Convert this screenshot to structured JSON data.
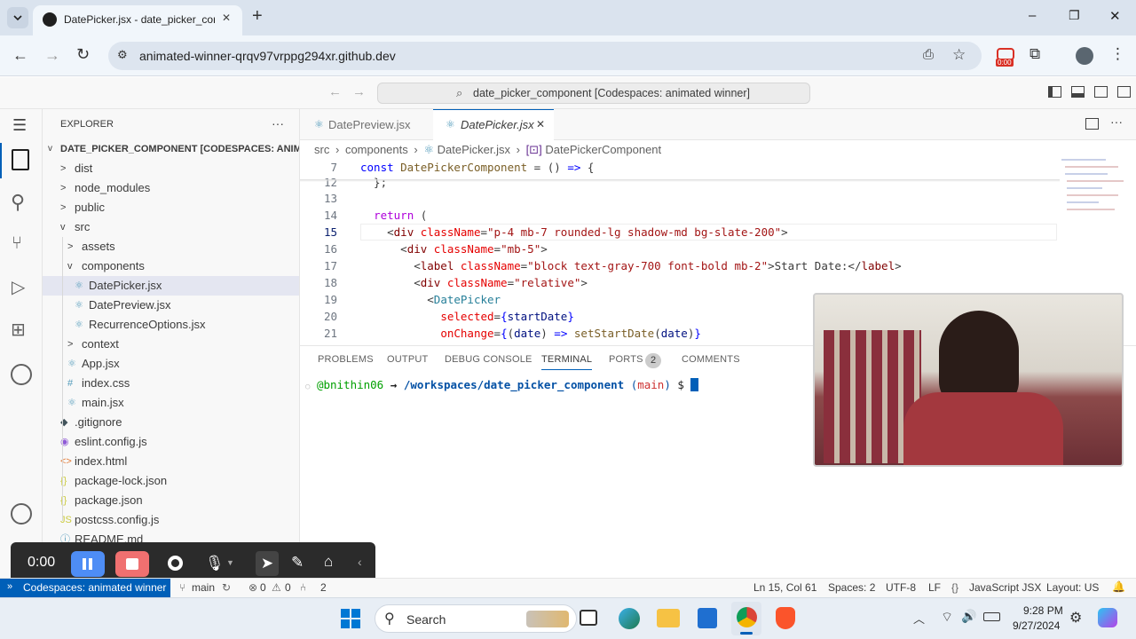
{
  "browser": {
    "tab_title": "DatePicker.jsx - date_picker_cor",
    "new_tab_symbol": "+",
    "url": "animated-winner-qrqv97vrppg294xr.github.dev",
    "recording_badge": "0:00",
    "window_controls": {
      "minimize": "–",
      "restore": "❐",
      "close": "✕"
    }
  },
  "vscode": {
    "command_center": "date_picker_component [Codespaces: animated winner]",
    "explorer": {
      "title": "EXPLORER",
      "more": "···",
      "root": "DATE_PICKER_COMPONENT [CODESPACES: ANIM...",
      "items": [
        {
          "label": "dist",
          "icon": ">"
        },
        {
          "label": "node_modules",
          "icon": ">"
        },
        {
          "label": "public",
          "icon": ">"
        },
        {
          "label": "src",
          "icon": "v"
        },
        {
          "label": "assets",
          "icon": ">"
        },
        {
          "label": "components",
          "icon": "v"
        },
        {
          "label": "DatePicker.jsx",
          "icon": "⚛"
        },
        {
          "label": "DatePreview.jsx",
          "icon": "⚛"
        },
        {
          "label": "RecurrenceOptions.jsx",
          "icon": "⚛"
        },
        {
          "label": "context",
          "icon": ">"
        },
        {
          "label": "App.jsx",
          "icon": "⚛"
        },
        {
          "label": "index.css",
          "icon": "#"
        },
        {
          "label": "main.jsx",
          "icon": "⚛"
        },
        {
          "label": ".gitignore",
          "icon": "◆"
        },
        {
          "label": "eslint.config.js",
          "icon": "◉"
        },
        {
          "label": "index.html",
          "icon": "<>"
        },
        {
          "label": "package-lock.json",
          "icon": "{}"
        },
        {
          "label": "package.json",
          "icon": "{}"
        },
        {
          "label": "postcss.config.js",
          "icon": "JS"
        },
        {
          "label": "README.md",
          "icon": "ⓘ"
        }
      ]
    },
    "tabs": [
      {
        "label": "DatePreview.jsx"
      },
      {
        "label": "DatePicker.jsx",
        "close": "✕"
      }
    ],
    "breadcrumb": {
      "parts": [
        "src",
        "components",
        "DatePicker.jsx",
        "DatePickerComponent"
      ],
      "sep": "›"
    },
    "code_lines": [
      {
        "n": "7",
        "tokens": [
          [
            "kw",
            "const "
          ],
          [
            "fn",
            "DatePickerComponent"
          ],
          [
            "pun",
            " = () "
          ],
          [
            "kw",
            "=>"
          ],
          [
            "pun",
            " {"
          ]
        ]
      },
      {
        "n": "12",
        "tokens": [
          [
            "pun",
            "  };"
          ]
        ]
      },
      {
        "n": "13",
        "tokens": []
      },
      {
        "n": "14",
        "tokens": [
          [
            "pun",
            "  "
          ],
          [
            "ctl",
            "return"
          ],
          [
            "pun",
            " ("
          ]
        ]
      },
      {
        "n": "15",
        "tokens": [
          [
            "pun",
            "    <"
          ],
          [
            "tag",
            "div"
          ],
          [
            "pun",
            " "
          ],
          [
            "attr",
            "className"
          ],
          [
            "pun",
            "="
          ],
          [
            "str",
            "\"p-4 mb-7 rounded-lg shadow-md bg-slate-200\""
          ],
          [
            "pun",
            ">"
          ]
        ]
      },
      {
        "n": "16",
        "tokens": [
          [
            "pun",
            "      <"
          ],
          [
            "tag",
            "div"
          ],
          [
            "pun",
            " "
          ],
          [
            "attr",
            "className"
          ],
          [
            "pun",
            "="
          ],
          [
            "str",
            "\"mb-5\""
          ],
          [
            "pun",
            ">"
          ]
        ]
      },
      {
        "n": "17",
        "tokens": [
          [
            "pun",
            "        <"
          ],
          [
            "tag",
            "label"
          ],
          [
            "pun",
            " "
          ],
          [
            "attr",
            "className"
          ],
          [
            "pun",
            "="
          ],
          [
            "str",
            "\"block text-gray-700 font-bold mb-2\""
          ],
          [
            "pun",
            ">Start Date:</"
          ],
          [
            "tag",
            "label"
          ],
          [
            "pun",
            ">"
          ]
        ]
      },
      {
        "n": "18",
        "tokens": [
          [
            "pun",
            "        <"
          ],
          [
            "tag",
            "div"
          ],
          [
            "pun",
            " "
          ],
          [
            "attr",
            "className"
          ],
          [
            "pun",
            "="
          ],
          [
            "str",
            "\"relative\""
          ],
          [
            "pun",
            ">"
          ]
        ]
      },
      {
        "n": "19",
        "tokens": [
          [
            "pun",
            "          <"
          ],
          [
            "comp",
            "DatePicker"
          ]
        ]
      },
      {
        "n": "20",
        "tokens": [
          [
            "pun",
            "            "
          ],
          [
            "attr",
            "selected"
          ],
          [
            "pun",
            "="
          ],
          [
            "kw",
            "{"
          ],
          [
            "var",
            "startDate"
          ],
          [
            "kw",
            "}"
          ]
        ]
      },
      {
        "n": "21",
        "tokens": [
          [
            "pun",
            "            "
          ],
          [
            "attr",
            "onChange"
          ],
          [
            "pun",
            "="
          ],
          [
            "kw",
            "{"
          ],
          [
            "pun",
            "("
          ],
          [
            "var",
            "date"
          ],
          [
            "pun",
            ") "
          ],
          [
            "kw",
            "=>"
          ],
          [
            "pun",
            " "
          ],
          [
            "fn",
            "setStartDate"
          ],
          [
            "pun",
            "("
          ],
          [
            "var",
            "date"
          ],
          [
            "pun",
            ")"
          ],
          [
            "kw",
            "}"
          ]
        ]
      }
    ],
    "panel_tabs": [
      "PROBLEMS",
      "OUTPUT",
      "DEBUG CONSOLE",
      "TERMINAL",
      "PORTS",
      "COMMENTS"
    ],
    "ports_badge": "2",
    "terminal": {
      "user": "@bnithin06",
      "arrow": "→",
      "path": "/workspaces/date_picker_component",
      "branch_open": "(",
      "branch": "main",
      "branch_close": ")",
      "prompt": "$"
    },
    "status": {
      "remote": "Codespaces: animated winner",
      "branch": "main",
      "errors": "0",
      "warnings": "0",
      "ports": "2",
      "position": "Ln 15, Col 61",
      "spaces": "Spaces: 2",
      "encoding": "UTF-8",
      "eol": "LF",
      "language": "JavaScript JSX",
      "layout": "Layout: US"
    }
  },
  "recorder": {
    "time": "0:00"
  },
  "taskbar": {
    "search": "Search",
    "time": "9:28 PM",
    "date": "9/27/2024"
  },
  "colors": {
    "accent": "#005fb8",
    "record_red": "#e81123",
    "recorder_bg": "#2b2b2b"
  }
}
